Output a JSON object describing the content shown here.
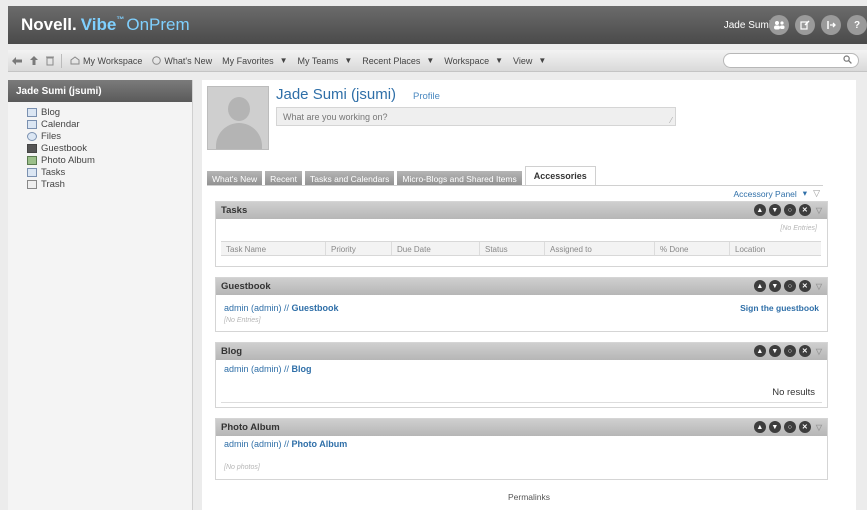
{
  "header": {
    "logo_brand": "Novell.",
    "logo_product": "Vibe",
    "logo_tm": "™",
    "logo_edition": "OnPrem",
    "user_name": "Jade Sumi",
    "icons": [
      "people-icon",
      "edit-icon",
      "logout-icon",
      "help-icon"
    ],
    "help_glyph": "?"
  },
  "toolbar": {
    "my_workspace": "My Workspace",
    "whats_new": "What's New",
    "my_favorites": "My Favorites",
    "my_teams": "My Teams",
    "recent_places": "Recent Places",
    "workspace": "Workspace",
    "view": "View",
    "arrow": "▼"
  },
  "sidebar": {
    "title": "Jade Sumi (jsumi)",
    "items": [
      {
        "label": "Blog",
        "icon": "blog-icon"
      },
      {
        "label": "Calendar",
        "icon": "calendar-icon"
      },
      {
        "label": "Files",
        "icon": "files-icon"
      },
      {
        "label": "Guestbook",
        "icon": "guestbook-icon"
      },
      {
        "label": "Photo Album",
        "icon": "photo-album-icon"
      },
      {
        "label": "Tasks",
        "icon": "tasks-icon"
      },
      {
        "label": "Trash",
        "icon": "trash-icon"
      }
    ]
  },
  "profile": {
    "name": "Jade Sumi (jsumi)",
    "profile_link": "Profile",
    "status_placeholder": "What are you working on?"
  },
  "tabs": [
    "What's New",
    "Recent",
    "Tasks and Calendars",
    "Micro-Blogs and Shared Items",
    "Accessories"
  ],
  "accessory_panel": "Accessory Panel",
  "portlets": {
    "tasks": {
      "title": "Tasks",
      "empty": "[No Entries]",
      "columns": [
        "Task Name",
        "Priority",
        "Due Date",
        "Status",
        "Assigned to",
        "% Done",
        "Location"
      ]
    },
    "guestbook": {
      "title": "Guestbook",
      "owner": "admin (admin) //",
      "folder": "Guestbook",
      "action": "Sign the guestbook",
      "empty": "[No Entries]"
    },
    "blog": {
      "title": "Blog",
      "owner": "admin (admin) //",
      "folder": "Blog",
      "result": "No results"
    },
    "photo_album": {
      "title": "Photo Album",
      "owner": "admin (admin) //",
      "folder": "Photo Album",
      "empty": "[No photos]"
    }
  },
  "footer": {
    "permalinks": "Permalinks"
  },
  "colors": {
    "header_bg": "#4a4a4a",
    "link": "#2f6fa8",
    "accent": "#7fd0ff"
  }
}
